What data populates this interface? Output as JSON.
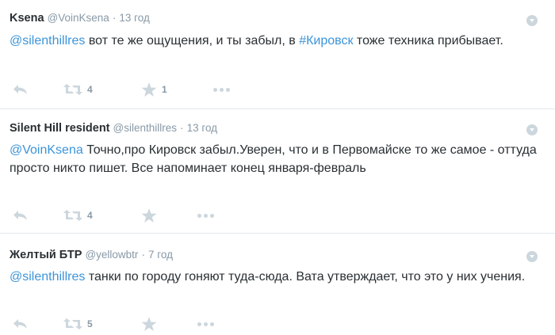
{
  "tweets": [
    {
      "name": "Ksena",
      "handle": "@VoinKsena",
      "dot": "·",
      "time": "13 год",
      "mention": "@silenthillres",
      "text_a": " вот те же ощущения, и ты забыл, в ",
      "hashtag": "#Кировск",
      "text_b": " тоже техника прибывает.",
      "retweets": "4",
      "favorites": "1"
    },
    {
      "name": "Silent Hill resident",
      "handle": "@silenthillres",
      "dot": "·",
      "time": "13 год",
      "mention": "@VoinKsena",
      "text_a": " Точно,про Кировск забыл.Уверен, что и в Первомайске то же самое - оттуда просто никто пишет. Все напоминает конец января-февраль",
      "retweets": "4"
    },
    {
      "name": "Желтый БТР",
      "handle": "@yellowbtr",
      "dot": "·",
      "time": "7 год",
      "mention": "@silenthillres",
      "text_a": " танки по городу гоняют туда-сюда. Вата утверждает, что это у них учения.",
      "retweets": "5"
    }
  ],
  "icons": {
    "reply": "reply-icon",
    "retweet": "retweet-icon",
    "favorite": "star-icon",
    "more": "more-icon",
    "caret": "caret-down-icon"
  },
  "colors": {
    "link": "#3b94d9",
    "muted": "#8899a6",
    "icon": "#ccd6dd",
    "divider": "#e1e8ed"
  }
}
